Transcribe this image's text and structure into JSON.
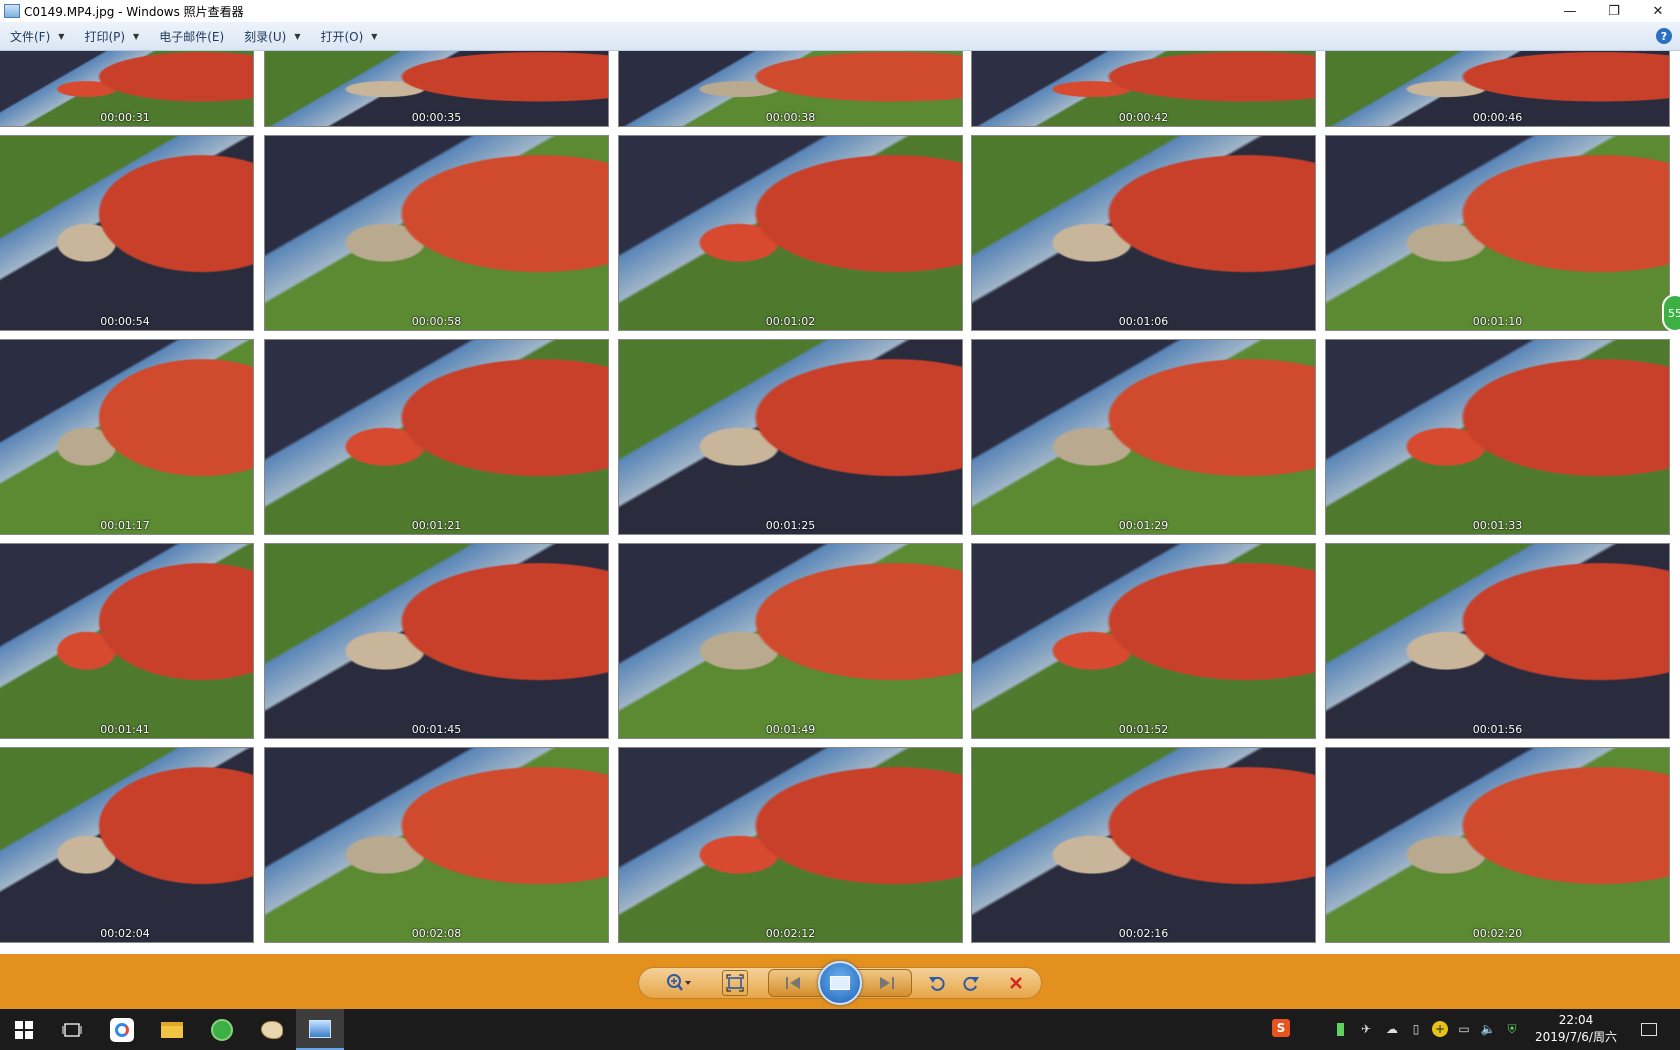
{
  "window": {
    "title": "C0149.MP4.jpg - Windows 照片查看器",
    "minimize_glyph": "—",
    "restore_glyph": "❐",
    "close_glyph": "✕"
  },
  "menu": {
    "items": [
      {
        "label": "文件(F)"
      },
      {
        "label": "打印(P)"
      },
      {
        "label": "电子邮件(E)"
      },
      {
        "label": "刻录(U)"
      },
      {
        "label": "打开(O)"
      }
    ],
    "help_glyph": "?"
  },
  "image": {
    "rows": [
      [
        "00:00:31",
        "00:00:35",
        "00:00:38",
        "00:00:42",
        "00:00:46"
      ],
      [
        "00:00:54",
        "00:00:58",
        "00:01:02",
        "00:01:06",
        "00:01:10"
      ],
      [
        "00:01:17",
        "00:01:21",
        "00:01:25",
        "00:01:29",
        "00:01:33"
      ],
      [
        "00:01:41",
        "00:01:45",
        "00:01:49",
        "00:01:52",
        "00:01:56"
      ],
      [
        "00:02:04",
        "00:02:08",
        "00:02:12",
        "00:02:16",
        "00:02:20"
      ]
    ],
    "badge_text": "55"
  },
  "controls": {
    "zoom_icon": "zoom-icon",
    "fit_icon": "actual-size-icon",
    "prev_icon": "previous-icon",
    "slideshow_icon": "slideshow-icon",
    "next_icon": "next-icon",
    "rotate_ccw_icon": "rotate-counterclockwise-icon",
    "rotate_cw_icon": "rotate-clockwise-icon",
    "delete_icon": "delete-icon",
    "accent": "#e3901e"
  },
  "taskbar": {
    "time": "22:04",
    "date": "2019/7/6/周六"
  }
}
